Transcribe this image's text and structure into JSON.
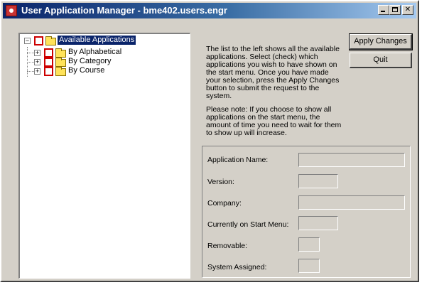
{
  "window": {
    "title": "User Application Manager - bme402.users.engr"
  },
  "tree": {
    "root": {
      "label": "Available Applications",
      "expander": "−"
    },
    "children": [
      {
        "label": "By Alphabetical",
        "expander": "+"
      },
      {
        "label": "By Category",
        "expander": "+"
      },
      {
        "label": "By Course",
        "expander": "+"
      }
    ]
  },
  "description": {
    "paragraph1": "The list to the left shows all the available applications. Select (check) which applications you wish to have shown on the start menu. Once you have made your selection, press the Apply Changes button to submit the request to the system.",
    "paragraph2": "Please note: If you choose to show all applications on the start menu, the amount of time you need to wait for them to show up will increase."
  },
  "buttons": {
    "apply": "Apply Changes",
    "quit": "Quit"
  },
  "details": {
    "fields": [
      {
        "label": "Application Name:",
        "value": ""
      },
      {
        "label": "Version:",
        "value": ""
      },
      {
        "label": "Company:",
        "value": ""
      },
      {
        "label": "Currently on Start Menu:",
        "value": ""
      },
      {
        "label": "Removable:",
        "value": ""
      },
      {
        "label": "System Assigned:",
        "value": ""
      }
    ]
  },
  "colors": {
    "titlebar_start": "#0a246a",
    "titlebar_end": "#a6caf0",
    "window_face": "#d4d0c8",
    "checkbox_border": "#cc0000",
    "folder": "#ffe35a",
    "selection": "#0a246a"
  },
  "icons": {
    "app": "app-icon",
    "minimize": "minimize-icon",
    "maximize": "maximize-icon",
    "close": "close-icon",
    "folder": "folder-icon",
    "checkbox": "checkbox-icon",
    "expander": "tree-expander-icon"
  }
}
